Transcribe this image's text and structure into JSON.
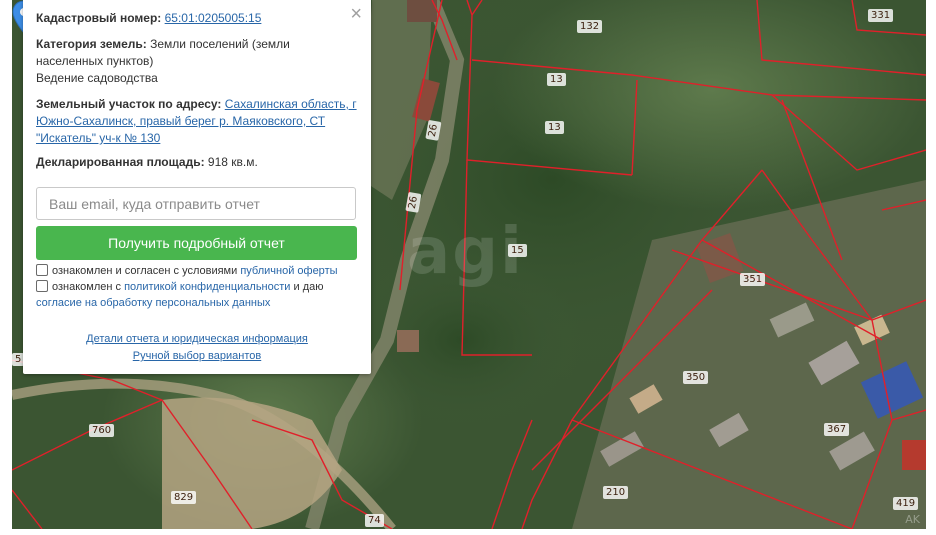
{
  "popup": {
    "cadastral_label": "Кадастровый номер:",
    "cadastral_value": "65:01:0205005:15",
    "category_label": "Категория земель:",
    "category_value": "Земли поселений (земли населенных пунктов)",
    "usage": "Ведение садоводства",
    "address_label": "Земельный участок по адресу:",
    "address_value": "Сахалинская область, г Южно-Сахалинск, правый берег р. Маяковского, СТ \"Искатель\" уч-к № 130",
    "area_label": "Декларированная площадь:",
    "area_value": "918 кв.м.",
    "email_placeholder": "Ваш email, куда отправить отчет",
    "submit_label": "Получить подробный отчет",
    "terms_prefix": "ознакомлен и согласен с условиями",
    "terms_link": "публичной оферты",
    "privacy_prefix": "ознакомлен с",
    "privacy_link": "политикой конфиденциальности",
    "privacy_middle": "и даю",
    "consent_link": "согласие на обработку персональных данных",
    "details_link": "Детали отчета и юридическая информация",
    "manual_link": "Ручной выбор вариантов",
    "close_icon": "×"
  },
  "map": {
    "watermark": "agi",
    "corner_mark": "AK",
    "plot_labels": [
      "132",
      "331",
      "13",
      "13",
      "26",
      "26",
      "15",
      "351",
      "5",
      "350",
      "760",
      "367",
      "829",
      "210",
      "74",
      "419"
    ],
    "boundary_color": "#e0202a",
    "marker_color": "#3d8ee6"
  }
}
